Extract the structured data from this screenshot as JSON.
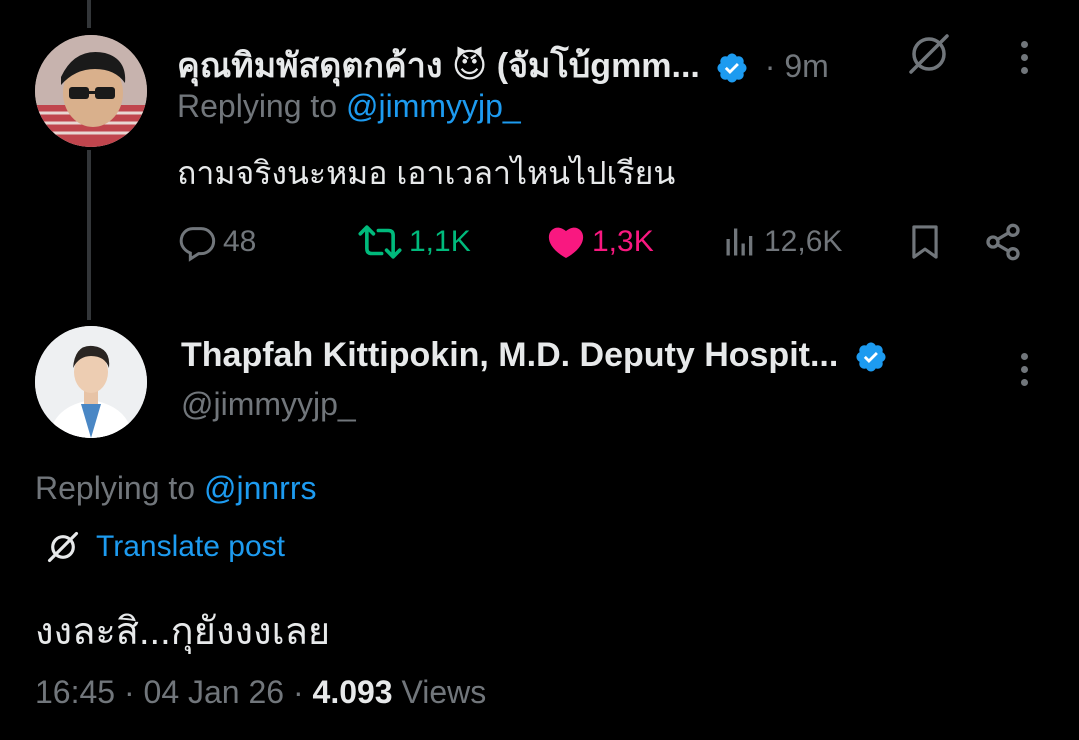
{
  "reply_tweet": {
    "display_name": "คุณทิมพัสดุตกค้าง 😈 (จัมโบ้gmm...",
    "time": "· 9m",
    "replying_prefix": "Replying to",
    "replying_handle": "@jimmyyjp_",
    "text": "ถามจริงนะหมอ เอาเวลาไหนไปเรียน",
    "stats": {
      "replies": "48",
      "reposts": "1,1K",
      "likes": "1,3K",
      "views": "12,6K"
    }
  },
  "main_tweet": {
    "display_name": "Thapfah Kittipokin, M.D. Deputy Hospit...",
    "handle": "@jimmyyjp_",
    "replying_prefix": "Replying to",
    "replying_handle": "@jnnrrs",
    "translate_label": "Translate post",
    "text": "งงละสิ...กุยังงงเลย",
    "time": "16:45",
    "date": "04 Jan 26",
    "views_count": "4.093",
    "views_label": "Views"
  },
  "colors": {
    "background": "#000000",
    "text": "#e7e9ea",
    "muted": "#71767b",
    "link": "#1d9bf0",
    "repost_active": "#00ba7c",
    "like_active": "#f91880"
  },
  "icons": [
    "verified-badge-icon",
    "grok-icon",
    "more-icon",
    "reply-icon",
    "repost-icon",
    "like-icon",
    "views-icon",
    "bookmark-icon",
    "share-icon",
    "translate-icon"
  ]
}
